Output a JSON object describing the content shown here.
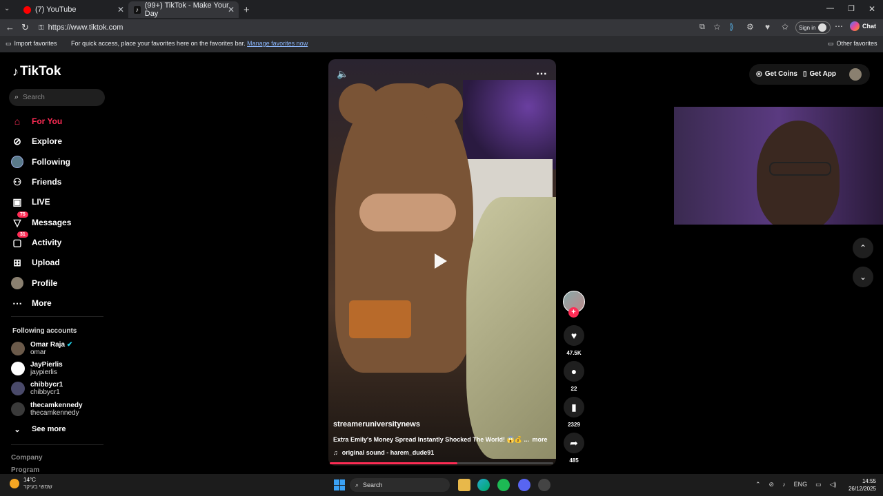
{
  "browser": {
    "tabs": [
      {
        "title": "(7) YouTube",
        "color": "#ff0000"
      },
      {
        "title": "(99+) TikTok - Make Your Day",
        "color": "#ffffff"
      }
    ],
    "new_tab": "+",
    "url": "https://www.tiktok.com",
    "sign_in": "Sign in",
    "chat": "Chat",
    "favorites": {
      "import": "Import favorites",
      "hint": "For quick access, place your favorites here on the favorites bar.",
      "manage": "Manage favorites now",
      "other": "Other favorites"
    }
  },
  "tiktok": {
    "logo": "TikTok",
    "search_placeholder": "Search",
    "nav": [
      {
        "label": "For You",
        "icon": "home-icon",
        "active": true
      },
      {
        "label": "Explore",
        "icon": "compass-icon"
      },
      {
        "label": "Following",
        "icon": "following-avatar-icon"
      },
      {
        "label": "Friends",
        "icon": "friends-icon"
      },
      {
        "label": "LIVE",
        "icon": "live-icon"
      },
      {
        "label": "Messages",
        "icon": "messages-icon",
        "badge": "75"
      },
      {
        "label": "Activity",
        "icon": "activity-icon",
        "badge": "31"
      },
      {
        "label": "Upload",
        "icon": "upload-icon"
      },
      {
        "label": "Profile",
        "icon": "profile-avatar-icon"
      },
      {
        "label": "More",
        "icon": "more-dots-icon"
      }
    ],
    "following_header": "Following accounts",
    "accounts": [
      {
        "name": "Omar Raja",
        "user": "omar",
        "verified": true
      },
      {
        "name": "JayPierlis",
        "user": "jaypierlis"
      },
      {
        "name": "chibbycr1",
        "user": "chibbycr1"
      },
      {
        "name": "thecamkennedy",
        "user": "thecamkennedy"
      }
    ],
    "see_more": "See more",
    "footer": [
      "Company",
      "Program"
    ],
    "get_coins": "Get Coins",
    "get_app": "Get App",
    "video": {
      "author": "streameruniversitynews",
      "caption": "Extra Emily's Money Spread Instantly Shocked The World! 😱💰 ...",
      "more": "more",
      "sound": "original sound - harem_dude91",
      "progress": 0.57
    },
    "actions": {
      "likes": "47.5K",
      "comments": "22",
      "saves": "2329",
      "shares": "485"
    }
  },
  "taskbar": {
    "weather_temp": "14°C",
    "weather_desc": "שמשי בעיקר",
    "search": "Search",
    "lang": "ENG",
    "time": "14:55",
    "date": "26/12/2025"
  },
  "colors": {
    "accent": "#fe2c55"
  }
}
